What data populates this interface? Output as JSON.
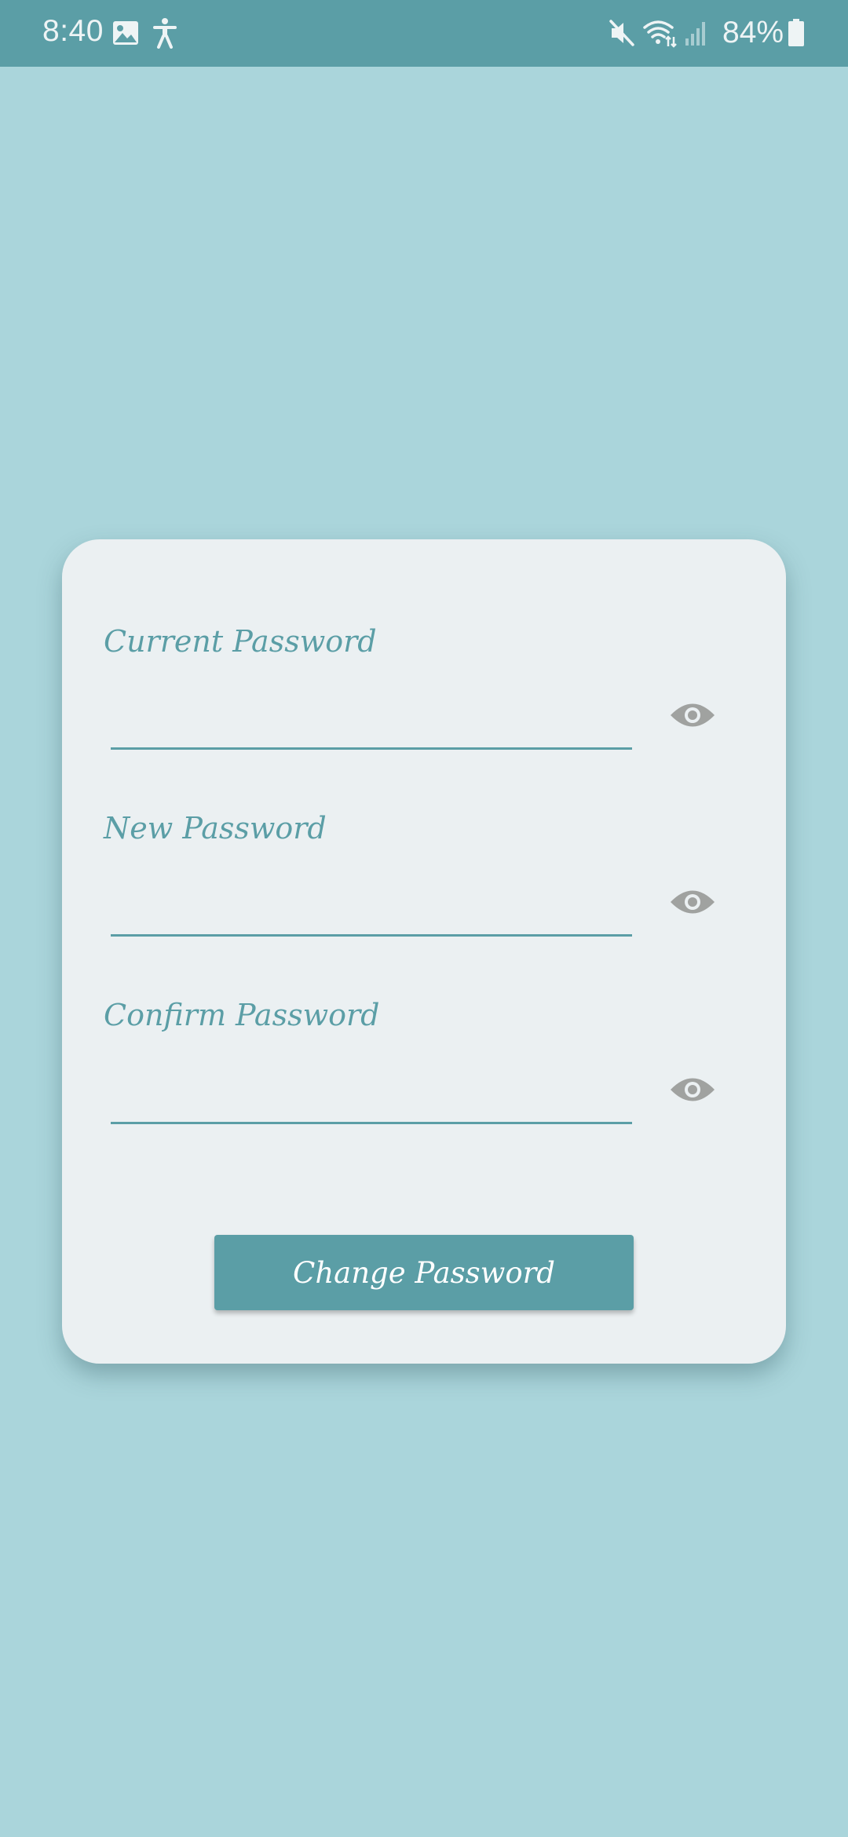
{
  "status_bar": {
    "time": "8:40",
    "battery_percent": "84%",
    "icons": [
      "image-icon",
      "accessibility-icon",
      "mute-icon",
      "wifi-icon",
      "signal-icon",
      "battery-icon"
    ]
  },
  "form": {
    "fields": [
      {
        "label": "Current Password",
        "value": "",
        "placeholder": ""
      },
      {
        "label": "New Password",
        "value": "",
        "placeholder": ""
      },
      {
        "label": "Confirm Password",
        "value": "",
        "placeholder": ""
      }
    ],
    "submit_label": "Change Password"
  },
  "colors": {
    "background": "#aad5db",
    "status_bar": "#5b9ea6",
    "card": "#ebf0f2",
    "accent": "#5b9ea6",
    "eye_icon": "#a0a2a0"
  }
}
